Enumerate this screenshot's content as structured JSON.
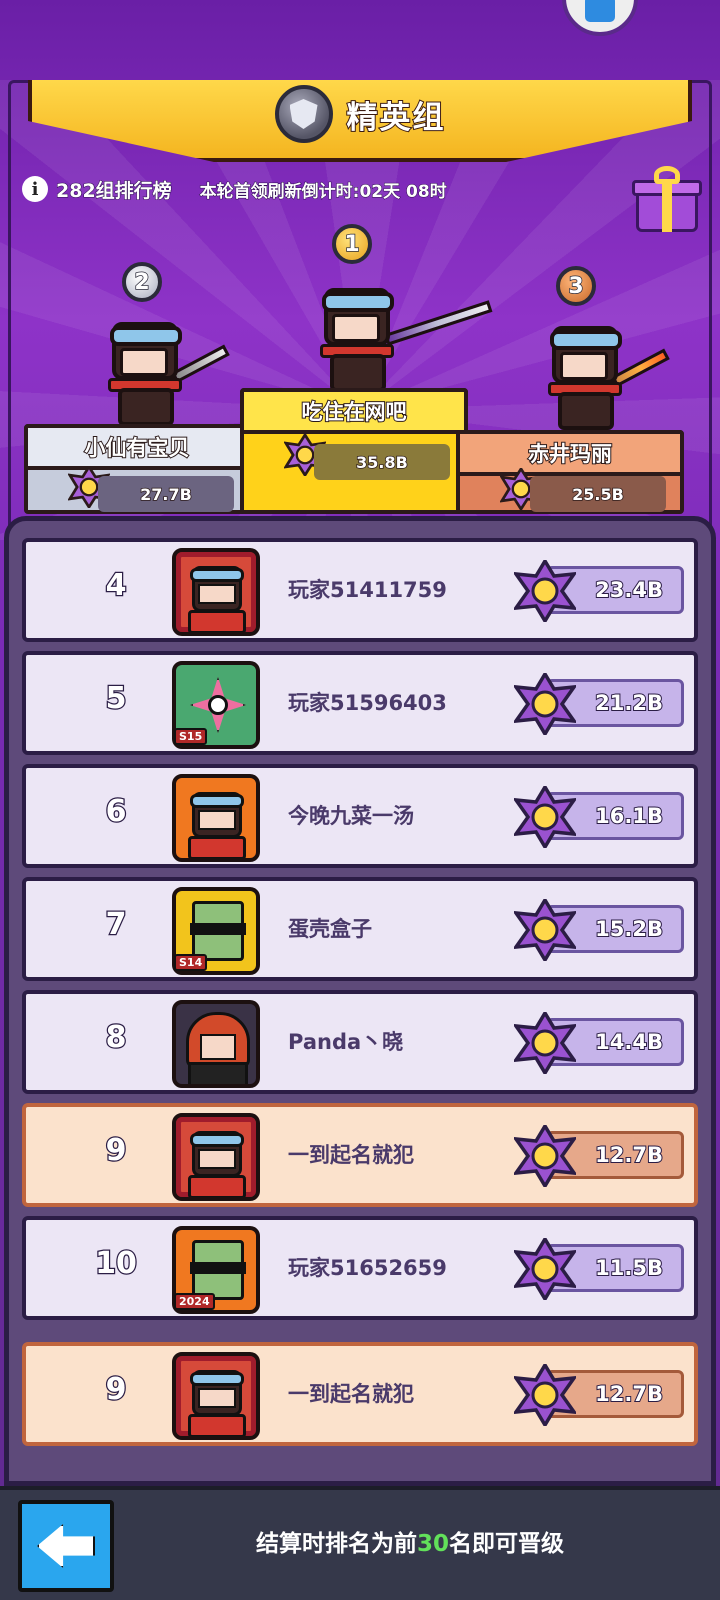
{
  "league": {
    "title": "精英组"
  },
  "info": {
    "group_label": "282组排行榜",
    "countdown": "本轮首领刷新倒计时:02天 08时"
  },
  "podium": [
    {
      "rank": "1",
      "name": "吃住在网吧",
      "score": "35.8B"
    },
    {
      "rank": "2",
      "name": "小仙有宝贝",
      "score": "27.7B"
    },
    {
      "rank": "3",
      "name": "赤井玛丽",
      "score": "25.5B"
    }
  ],
  "rows": [
    {
      "rank": "4",
      "name": "玩家51411759",
      "score": "23.4B",
      "avatar": "crown-hero-avatar"
    },
    {
      "rank": "5",
      "name": "玩家51596403",
      "score": "21.2B",
      "avatar": "flower-avatar",
      "tag": "S15"
    },
    {
      "rank": "6",
      "name": "今晚九菜一汤",
      "score": "16.1B",
      "avatar": "crown-hero-avatar"
    },
    {
      "rank": "7",
      "name": "蛋壳盒子",
      "score": "15.2B",
      "avatar": "zombie-avatar",
      "tag": "S14"
    },
    {
      "rank": "8",
      "name": "Panda丶晓",
      "score": "14.4B",
      "avatar": "redhair-avatar"
    },
    {
      "rank": "9",
      "name": "一到起名就犯",
      "score": "12.7B",
      "avatar": "crown-hero-avatar",
      "highlight": true
    },
    {
      "rank": "10",
      "name": "玩家51652659",
      "score": "11.5B",
      "avatar": "zombie-avatar",
      "tag": "2024"
    }
  ],
  "self_row": {
    "rank": "9",
    "name": "一到起名就犯",
    "score": "12.7B"
  },
  "footer": {
    "text_before": "结算时排名为前",
    "highlight": "30",
    "text_after": "名即可晋级"
  },
  "colors": {
    "accent_gold": "#ffd21a",
    "panel": "#5e4a7a",
    "self_highlight": "#fbe2cc",
    "footer_highlight": "#62e05a"
  }
}
